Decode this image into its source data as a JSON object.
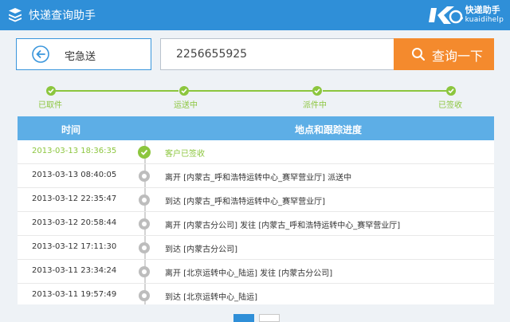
{
  "app": {
    "title": "快递查询助手"
  },
  "brand": {
    "name_cn": "快递助手",
    "name_en": "kuaidihelp"
  },
  "search": {
    "company": "宅急送",
    "tracking_number": "2256655925",
    "query_label": "查询一下"
  },
  "progress": {
    "steps": [
      {
        "label": "已取件",
        "done": true
      },
      {
        "label": "运送中",
        "done": true
      },
      {
        "label": "派件中",
        "done": true
      },
      {
        "label": "已签收",
        "done": true
      }
    ]
  },
  "table": {
    "headers": {
      "time": "时间",
      "detail": "地点和跟踪进度"
    },
    "rows": [
      {
        "time": "2013-03-13 18:36:35",
        "desc": "客户已签收",
        "current": true
      },
      {
        "time": "2013-03-13 08:40:05",
        "desc": "离开 [内蒙古_呼和浩特运转中心_赛罕营业厅] 派送中"
      },
      {
        "time": "2013-03-12 22:35:47",
        "desc": "到达 [内蒙古_呼和浩特运转中心_赛罕营业厅]"
      },
      {
        "time": "2013-03-12 20:58:44",
        "desc": "离开 [内蒙古分公司] 发往 [内蒙古_呼和浩特运转中心_赛罕营业厅]"
      },
      {
        "time": "2013-03-12 17:11:30",
        "desc": "到达 [内蒙古分公司]"
      },
      {
        "time": "2013-03-11 23:34:24",
        "desc": "离开 [北京运转中心_陆运] 发往 [内蒙古分公司]"
      },
      {
        "time": "2013-03-11 19:57:49",
        "desc": "到达 [北京运转中心_陆运]"
      }
    ]
  },
  "pagination": {
    "current_page": 1
  },
  "colors": {
    "header_blue": "#2f8fd8",
    "accent_orange": "#f48a2d",
    "progress_green": "#8cc63e",
    "table_head": "#5daee6"
  },
  "icons": [
    "package-stack-icon",
    "brand-logo-icon",
    "back-arrow-icon",
    "search-icon",
    "check-icon"
  ]
}
